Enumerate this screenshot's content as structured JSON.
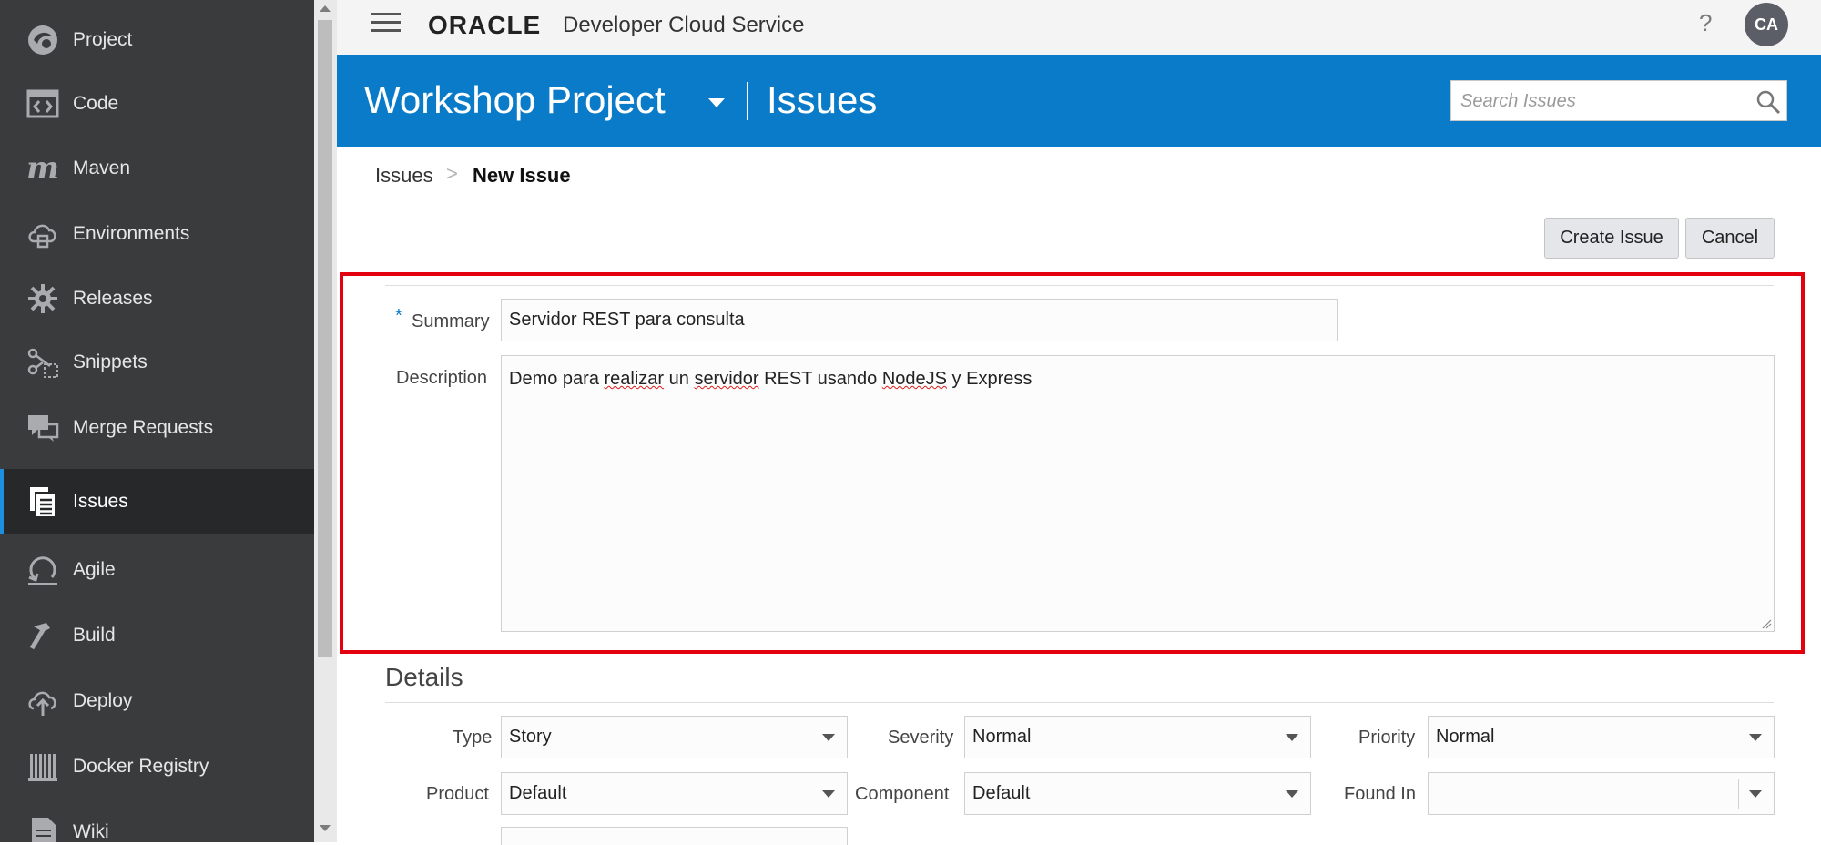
{
  "sidebar": {
    "items": [
      {
        "label": "Project",
        "icon": "project-icon"
      },
      {
        "label": "Code",
        "icon": "code-icon"
      },
      {
        "label": "Maven",
        "icon": "maven-icon"
      },
      {
        "label": "Environments",
        "icon": "environments-icon"
      },
      {
        "label": "Releases",
        "icon": "releases-icon"
      },
      {
        "label": "Snippets",
        "icon": "snippets-icon"
      },
      {
        "label": "Merge Requests",
        "icon": "merge-requests-icon"
      },
      {
        "label": "Issues",
        "icon": "issues-icon",
        "active": true
      },
      {
        "label": "Agile",
        "icon": "agile-icon"
      },
      {
        "label": "Build",
        "icon": "build-icon"
      },
      {
        "label": "Deploy",
        "icon": "deploy-icon"
      },
      {
        "label": "Docker Registry",
        "icon": "docker-registry-icon"
      },
      {
        "label": "Wiki",
        "icon": "wiki-icon"
      }
    ]
  },
  "topbar": {
    "logo": "ORACLE",
    "product": "Developer Cloud Service",
    "help": "?",
    "avatar": "CA"
  },
  "header": {
    "project": "Workshop Project",
    "page": "Issues",
    "search_placeholder": "Search Issues"
  },
  "breadcrumb": {
    "parent": "Issues",
    "separator": ">",
    "current": "New Issue"
  },
  "actions": {
    "create": "Create Issue",
    "cancel": "Cancel"
  },
  "form": {
    "required_mark": "*",
    "summary_label": "Summary",
    "summary_value": "Servidor REST para consulta",
    "description_label": "Description",
    "description_value": "Demo para realizar un servidor REST usando NodeJS y Express",
    "description_parts": [
      "Demo para ",
      "realizar",
      " un ",
      "servidor",
      " REST usando ",
      "NodeJS",
      " y Express"
    ]
  },
  "details": {
    "heading": "Details",
    "type": {
      "label": "Type",
      "value": "Story"
    },
    "severity": {
      "label": "Severity",
      "value": "Normal"
    },
    "priority": {
      "label": "Priority",
      "value": "Normal"
    },
    "product": {
      "label": "Product",
      "value": "Default"
    },
    "component": {
      "label": "Component",
      "value": "Default"
    },
    "found_in": {
      "label": "Found In",
      "value": ""
    }
  },
  "colors": {
    "sidebar_bg": "#3a3b3d",
    "header_blue": "#0a7bc8",
    "highlight_red": "#e3000f",
    "active_accent": "#1d8fe0"
  }
}
